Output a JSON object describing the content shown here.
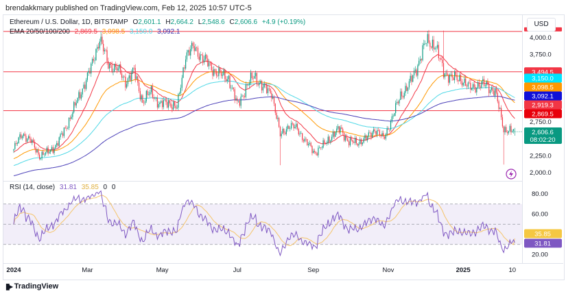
{
  "header": {
    "published": "brendakkmary published on TradingView.com, Feb 12, 2025 10:57 UTC-5"
  },
  "legend": {
    "symbol": "Ethereum / U.S. Dollar, 1D, BITSTAMP",
    "open_label": "O",
    "open": "2,601.1",
    "high_label": "H",
    "high": "2,664.2",
    "low_label": "L",
    "low": "2,548.6",
    "close_label": "C",
    "close": "2,606.6",
    "change": "+4.9 (+0.19%)",
    "ema_title": "EMA 20/50/100/200",
    "ema20": "2,869.5",
    "ema50": "3,098.5",
    "ema100": "3,150.0",
    "ema200": "3,092.1"
  },
  "rsi_legend": {
    "title": "RSI (14, close)",
    "rsi": "31.81",
    "ma": "35.85",
    "extra1": "0",
    "extra2": "0"
  },
  "currency_button": "USD",
  "footer": {
    "brand": "TradingView"
  },
  "colors": {
    "up": "#089981",
    "down": "#f23645",
    "ema20": "#f23645",
    "ema50": "#ff9800",
    "ema100": "#4dd8e6",
    "ema200": "#4a3fb8",
    "rsi": "#7e57c2",
    "rsi_ma": "#f5c46a",
    "hline": "#f23645",
    "last_price": "#089981"
  },
  "chart_data": [
    {
      "type": "candlestick",
      "title": "Ethereum / U.S. Dollar, 1D, BITSTAMP",
      "x_ticks": [
        {
          "label": "2024",
          "date": "2024-01-01"
        },
        {
          "label": "Mar",
          "date": "2024-03-01"
        },
        {
          "label": "May",
          "date": "2024-05-01"
        },
        {
          "label": "Jul",
          "date": "2024-07-01"
        },
        {
          "label": "Sep",
          "date": "2024-09-01"
        },
        {
          "label": "Nov",
          "date": "2024-11-01"
        },
        {
          "label": "2025",
          "date": "2025-01-01"
        },
        {
          "label": "10",
          "date": "2025-02-10"
        }
      ],
      "y_ticks": [
        "4,000.0",
        "3,750.0",
        "2,750.0",
        "2,250.0",
        "2,000.0"
      ],
      "y_tick_values": [
        4000,
        3750,
        2750,
        2250,
        2000
      ],
      "ylim": [
        1950,
        4150
      ],
      "weekly_close_approx": [
        [
          "2024-01-01",
          2350
        ],
        [
          "2024-01-08",
          2580
        ],
        [
          "2024-01-15",
          2470
        ],
        [
          "2024-01-22",
          2250
        ],
        [
          "2024-01-29",
          2300
        ],
        [
          "2024-02-05",
          2420
        ],
        [
          "2024-02-12",
          2650
        ],
        [
          "2024-02-19",
          2950
        ],
        [
          "2024-02-26",
          3250
        ],
        [
          "2024-03-04",
          3550
        ],
        [
          "2024-03-11",
          4000
        ],
        [
          "2024-03-18",
          3600
        ],
        [
          "2024-03-25",
          3550
        ],
        [
          "2024-04-01",
          3350
        ],
        [
          "2024-04-08",
          3500
        ],
        [
          "2024-04-15",
          3050
        ],
        [
          "2024-04-22",
          3200
        ],
        [
          "2024-04-29",
          3000
        ],
        [
          "2024-05-06",
          3050
        ],
        [
          "2024-05-13",
          2950
        ],
        [
          "2024-05-20",
          3750
        ],
        [
          "2024-05-27",
          3850
        ],
        [
          "2024-06-03",
          3700
        ],
        [
          "2024-06-10",
          3550
        ],
        [
          "2024-06-17",
          3450
        ],
        [
          "2024-06-24",
          3400
        ],
        [
          "2024-07-01",
          3000
        ],
        [
          "2024-07-08",
          3250
        ],
        [
          "2024-07-15",
          3450
        ],
        [
          "2024-07-22",
          3250
        ],
        [
          "2024-07-29",
          3200
        ],
        [
          "2024-08-05",
          2550
        ],
        [
          "2024-08-12",
          2700
        ],
        [
          "2024-08-19",
          2650
        ],
        [
          "2024-08-26",
          2450
        ],
        [
          "2024-09-02",
          2300
        ],
        [
          "2024-09-09",
          2400
        ],
        [
          "2024-09-16",
          2550
        ],
        [
          "2024-09-23",
          2650
        ],
        [
          "2024-09-30",
          2450
        ],
        [
          "2024-10-07",
          2450
        ],
        [
          "2024-10-14",
          2500
        ],
        [
          "2024-10-21",
          2650
        ],
        [
          "2024-10-28",
          2500
        ],
        [
          "2024-11-04",
          2800
        ],
        [
          "2024-11-11",
          3150
        ],
        [
          "2024-11-18",
          3300
        ],
        [
          "2024-11-25",
          3600
        ],
        [
          "2024-12-02",
          3950
        ],
        [
          "2024-12-09",
          3900
        ],
        [
          "2024-12-16",
          3500
        ],
        [
          "2024-12-23",
          3400
        ],
        [
          "2024-12-30",
          3400
        ],
        [
          "2025-01-06",
          3250
        ],
        [
          "2025-01-13",
          3300
        ],
        [
          "2025-01-20",
          3300
        ],
        [
          "2025-01-27",
          3200
        ],
        [
          "2025-02-03",
          2650
        ],
        [
          "2025-02-10",
          2606.6
        ]
      ],
      "notable_lows": [
        [
          "2024-08-05",
          2110
        ],
        [
          "2025-02-03",
          2120
        ]
      ],
      "notable_highs": [
        [
          "2024-03-12",
          4090
        ],
        [
          "2024-12-16",
          4105
        ]
      ],
      "last_candle": {
        "date": "2025-02-12",
        "open": 2601.1,
        "high": 2664.2,
        "low": 2548.6,
        "close": 2606.6
      },
      "horizontal_lines": [
        {
          "value": 4093,
          "label": ""
        },
        {
          "value": 3494.5,
          "label": "3,494.5"
        },
        {
          "value": 2919.3,
          "label": "2,919.3"
        }
      ],
      "ema": [
        {
          "name": "EMA 20",
          "last": 2869.5,
          "label": "2,869.5"
        },
        {
          "name": "EMA 50",
          "last": 3098.5,
          "label": "3,098.5"
        },
        {
          "name": "EMA 100",
          "last": 3150.0,
          "label": "3,150.0"
        },
        {
          "name": "EMA 200",
          "last": 3092.1,
          "label": "3,092.1"
        }
      ],
      "last_price_label": "2,606.6",
      "countdown": "08:02:20"
    },
    {
      "type": "line",
      "title": "RSI (14, close)",
      "y_ticks": [
        "80.00",
        "60.00",
        "20.00"
      ],
      "y_tick_values": [
        80,
        60,
        20
      ],
      "ylim": [
        15,
        90
      ],
      "bands": [
        70,
        50,
        30
      ],
      "series": [
        {
          "name": "RSI",
          "last": 31.81,
          "label": "31.81"
        },
        {
          "name": "RSI-based MA",
          "last": 35.85,
          "label": "35.85"
        }
      ]
    }
  ]
}
